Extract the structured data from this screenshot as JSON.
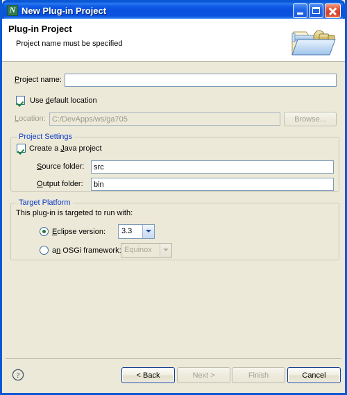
{
  "window": {
    "title": "New Plug-in Project",
    "app_icon": "eclipse-plugin-icon",
    "caption_buttons": {
      "minimize": "minimize-button",
      "maximize": "maximize-button",
      "close": "close-button"
    }
  },
  "header": {
    "title": "Plug-in Project",
    "subtitle": "Project name must be specified",
    "icon": "plug-in-project-folder-icon"
  },
  "form": {
    "project_name": {
      "label": "Project name:",
      "mnemonic": "P",
      "value": "",
      "placeholder": ""
    },
    "use_default_location": {
      "label_before": "Use ",
      "mnemonic": "d",
      "label_after": "efault location",
      "full_label": "Use default location",
      "checked": true
    },
    "location": {
      "label": "Location:",
      "mnemonic": "L",
      "value": "C:/DevApps/ws/ga705",
      "enabled": false
    },
    "browse_button": {
      "label": "Browse...",
      "mnemonic": "B",
      "enabled": false
    }
  },
  "project_settings": {
    "group_title": "Project Settings",
    "create_java_project": {
      "label_before": "Create a ",
      "mnemonic": "J",
      "label_after": "ava project",
      "full_label": "Create a Java project",
      "checked": true
    },
    "source_folder": {
      "label": "Source folder:",
      "mnemonic": "S",
      "value": "src"
    },
    "output_folder": {
      "label": "Output folder:",
      "mnemonic": "O",
      "value": "bin"
    }
  },
  "target_platform": {
    "group_title": "Target Platform",
    "description": "This plug-in is targeted to run with:",
    "eclipse_version": {
      "label_before": "E",
      "mnemonic": "E",
      "label_after": "clipse version:",
      "full_label": "Eclipse version:",
      "selected": true,
      "value": "3.3",
      "options": [
        "3.3"
      ]
    },
    "osgi_framework": {
      "label_before": "a",
      "mnemonic": "n",
      "label_after": " OSGi framework:",
      "full_label": "an OSGi framework:",
      "selected": false,
      "value": "Equinox",
      "enabled": false,
      "options": [
        "Equinox"
      ]
    }
  },
  "buttons": {
    "help": "help-icon",
    "back": {
      "label": "< Back",
      "enabled": true,
      "default": true
    },
    "next": {
      "label": "Next >",
      "enabled": false
    },
    "finish": {
      "label": "Finish",
      "enabled": false
    },
    "cancel": {
      "label": "Cancel",
      "enabled": true
    }
  },
  "colors": {
    "dialog_bg": "#ECE9D8",
    "title_blue": "#0A51DF",
    "group_label_blue": "#0A3AC8",
    "field_border": "#7D9BB5",
    "check_green": "#14892C",
    "close_red": "#D0402A"
  }
}
